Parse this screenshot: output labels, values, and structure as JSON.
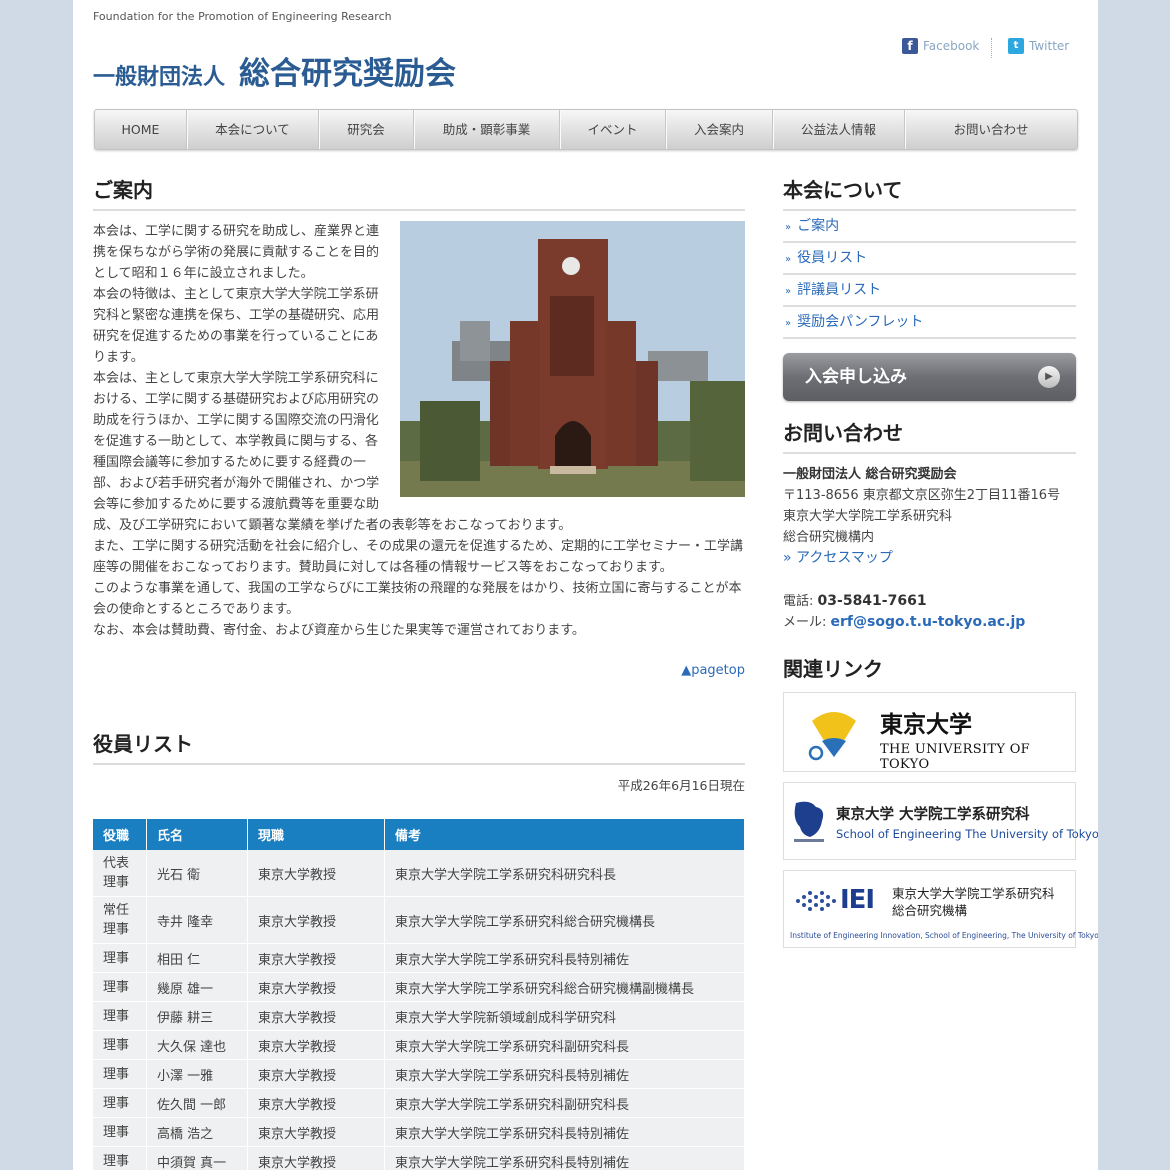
{
  "header": {
    "tagline": "Foundation for the Promotion of Engineering Research",
    "logo_prefix": "一般財団法人",
    "logo_name": "総合研究奨励会",
    "social": {
      "facebook": "Facebook",
      "twitter": "Twitter"
    }
  },
  "nav": [
    "HOME",
    "本会について",
    "研究会",
    "助成・顕彰事業",
    "イベント",
    "入会案内",
    "公益法人情報",
    "お問い合わせ"
  ],
  "intro": {
    "title": "ご案内",
    "paragraphs": [
      "本会は、工学に関する研究を助成し、産業界と連携を保ちながら学術の発展に貢献することを目的として昭和１６年に設立されました。",
      "本会の特徴は、主として東京大学大学院工学系研究科と緊密な連携を保ち、工学の基礎研究、応用研究を促進するための事業を行っていることにあります。",
      "本会は、主として東京大学大学院工学系研究科における、工学に関する基礎研究および応用研究の助成を行うほか、工学に関する国際交流の円滑化を促進する一助として、本学教員に関与する、各種国際会議等に参加するために要する経費の一部、および若手研究者が海外で開催され、かつ学会等に参加するために要する渡航費等を重要な助成、及び工学研究において顕著な業績を挙げた者の表彰等をおこなっております。",
      "また、工学に関する研究活動を社会に紹介し、その成果の還元を促進するため、定期的に工学セミナー・工学講座等の開催をおこなっております。賛助員に対しては各種の情報サービス等をおこなっております。",
      "このような事業を通して、我国の工学ならびに工業技術の飛躍的な発展をはかり、技術立国に寄与することが本会の使命とするところであります。",
      "なお、本会は賛助費、寄付金、および資産から生じた果実等で運営されております。"
    ],
    "pagetop": "▲pagetop"
  },
  "officers": {
    "title": "役員リスト",
    "date": "平成26年6月16日現在",
    "columns": [
      "役職",
      "氏名",
      "現職",
      "備考"
    ],
    "rows": [
      [
        "代表理事",
        "光石 衛",
        "東京大学教授",
        "東京大学大学院工学系研究科研究科長"
      ],
      [
        "常任理事",
        "寺井 隆幸",
        "東京大学教授",
        "東京大学大学院工学系研究科総合研究機構長"
      ],
      [
        "理事",
        "相田 仁",
        "東京大学教授",
        "東京大学大学院工学系研究科長特別補佐"
      ],
      [
        "理事",
        "幾原 雄一",
        "東京大学教授",
        "東京大学大学院工学系研究科総合研究機構副機構長"
      ],
      [
        "理事",
        "伊藤 耕三",
        "東京大学教授",
        "東京大学大学院新領域創成科学研究科"
      ],
      [
        "理事",
        "大久保 達也",
        "東京大学教授",
        "東京大学大学院工学系研究科副研究科長"
      ],
      [
        "理事",
        "小澤 一雅",
        "東京大学教授",
        "東京大学大学院工学系研究科長特別補佐"
      ],
      [
        "理事",
        "佐久間 一郎",
        "東京大学教授",
        "東京大学大学院工学系研究科副研究科長"
      ],
      [
        "理事",
        "高橋 浩之",
        "東京大学教授",
        "東京大学大学院工学系研究科長特別補佐"
      ],
      [
        "理事",
        "中須賀 真一",
        "東京大学教授",
        "東京大学大学院工学系研究科長特別補佐"
      ]
    ]
  },
  "sidebar": {
    "about_title": "本会について",
    "links": [
      "ご案内",
      "役員リスト",
      "評議員リスト",
      "奨励会パンフレット"
    ],
    "join_label": "入会申し込み",
    "contact_title": "お問い合わせ",
    "contact": {
      "org": "一般財団法人 総合研究奨励会",
      "address1": "〒113-8656 東京都文京区弥生2丁目11番16号",
      "address2": "東京大学大学院工学系研究科",
      "address3": "総合研究機構内",
      "access": "» アクセスマップ",
      "phone_label": "電話:",
      "phone": "03-5841-7661",
      "mail_label": "メール:",
      "mail": "erf@sogo.t.u-tokyo.ac.jp"
    },
    "related_title": "関連リンク",
    "banners": {
      "utokyo_ja": "東京大学",
      "utokyo_en": "THE UNIVERSITY OF TOKYO",
      "eng_ja": "東京大学 大学院工学系研究科",
      "eng_en": "School of Engineering The University of Tokyo",
      "iei_mark": "IEI",
      "iei_ja1": "東京大学大学院工学系研究科",
      "iei_ja2": "総合研究機構",
      "iei_en": "Institute of Engineering Innovation, School of Engineering, The University of Tokyo"
    }
  }
}
